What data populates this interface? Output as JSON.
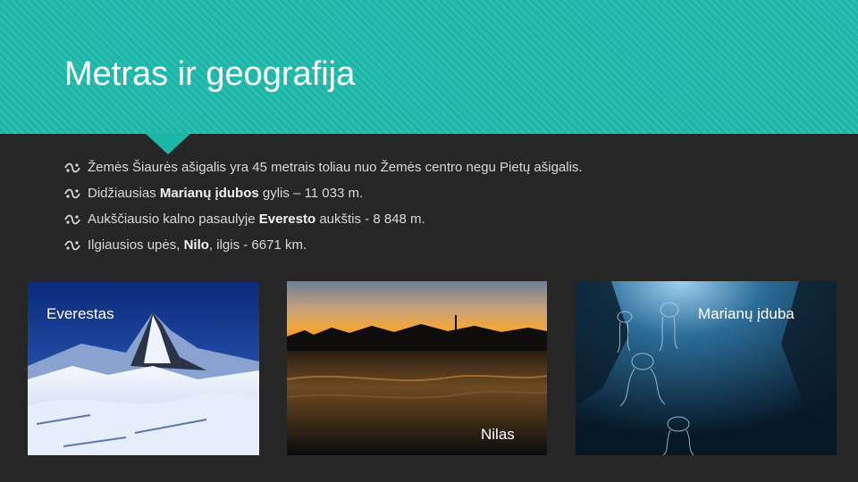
{
  "slide": {
    "title": "Metras ir geografija",
    "bullets": [
      {
        "segments": [
          "Žemės Šiaurės ašigalis yra 45 metrais toliau nuo Žemės centro negu Pietų ašigalis."
        ]
      },
      {
        "segments": [
          "Didžiausias ",
          "Marianų įdubos",
          " gylis – 11 033 m."
        ]
      },
      {
        "segments": [
          "Aukščiausio kalno pasaulyje ",
          "Everesto",
          " aukštis - 8 848 m."
        ]
      },
      {
        "segments": [
          "Ilgiausios upės, ",
          "Nilo",
          ", ilgis - 6671 km."
        ]
      }
    ],
    "bullet_icon": "flourish-icon"
  },
  "images": [
    {
      "caption": "Everestas",
      "depicts": "snowy-mountain-photo"
    },
    {
      "caption": "Nilas",
      "depicts": "river-sunset-photo"
    },
    {
      "caption": "Marianų įduba",
      "depicts": "deep-sea-jellyfish-photo"
    }
  ],
  "colors": {
    "header": "#1cb6a8",
    "background": "#262626",
    "text": "#d9d9d9"
  }
}
